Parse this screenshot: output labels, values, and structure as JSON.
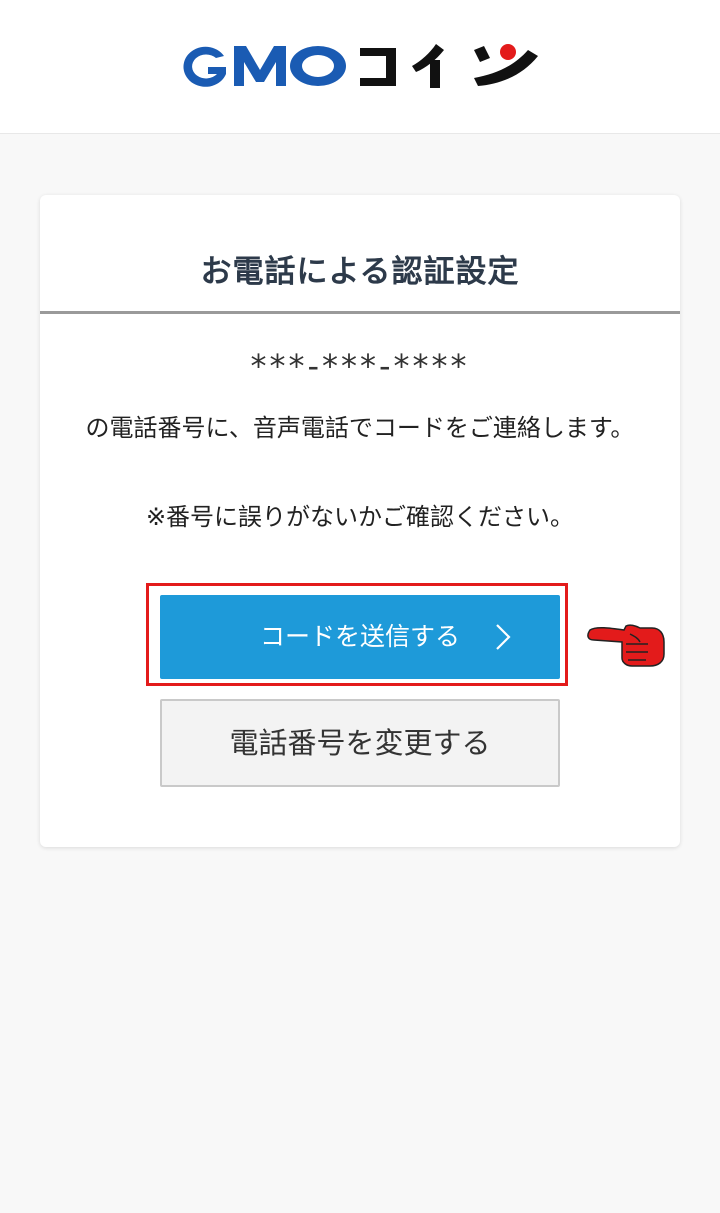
{
  "header": {
    "logo_text_latin": "GMO",
    "logo_text_kana": "コイン",
    "colors": {
      "logo_blue": "#1a5bb3",
      "logo_black": "#111111",
      "logo_red_dot": "#e31b1b"
    }
  },
  "card": {
    "title": "お電話による認証設定",
    "masked_phone": "***-***-****",
    "message": "の電話番号に、音声電話でコードをご連絡します。",
    "note": "※番号に誤りがないかご確認ください。",
    "send_button_label": "コードを送信する",
    "change_button_label": "電話番号を変更する"
  },
  "annotations": {
    "highlight_color": "#e31b1b",
    "pointer_icon": "pointing-hand-icon"
  },
  "colors": {
    "primary_button": "#1e9ad9",
    "title_text": "#2d3a4a",
    "background": "#f8f8f8"
  }
}
